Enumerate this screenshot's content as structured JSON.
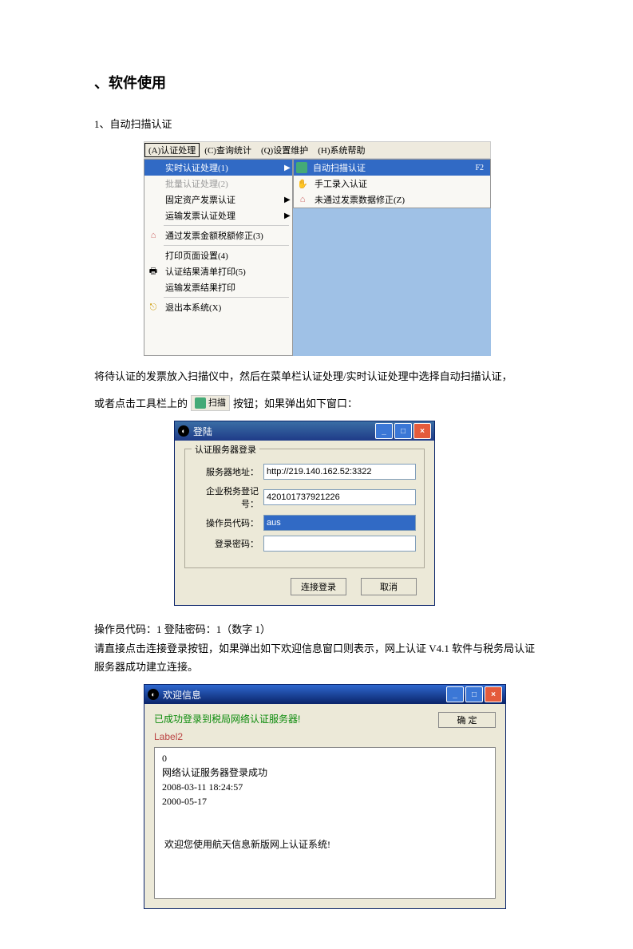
{
  "heading": "、软件使用",
  "section1_title": "1、自动扫描认证",
  "menubar": {
    "a": "(A)认证处理",
    "c": "(C)查询统计",
    "q": "(Q)设置维护",
    "h": "(H)系统帮助"
  },
  "mainmenu": {
    "i1": "实时认证处理(1)",
    "i2": "批量认证处理(2)",
    "i3": "固定资产发票认证",
    "i4": "运输发票认证处理",
    "i5": "通过发票金额税额修正(3)",
    "i6": "打印页面设置(4)",
    "i7": "认证结果清单打印(5)",
    "i8": "运输发票结果打印",
    "i9": "退出本系统(X)"
  },
  "submenu": {
    "s1": "自动扫描认证",
    "s1_key": "F2",
    "s2": "手工录入认证",
    "s3": "未通过发票数据修正(Z)"
  },
  "para_after_menu": "将待认证的发票放入扫描仪中，然后在菜单栏认证处理/实时认证处理中选择自动扫描认证，",
  "inline_before": "或者点击工具栏上的",
  "scan_btn_label": "扫描",
  "inline_after": "按钮；如果弹出如下窗口：",
  "login": {
    "title": "登陆",
    "group": "认证服务器登录",
    "f1_label": "服务器地址：",
    "f1_value": "http://219.140.162.52:3322",
    "f2_label": "企业税务登记号：",
    "f2_value": "420101737921226",
    "f3_label": "操作员代码：",
    "f3_value": "aus",
    "f4_label": "登录密码：",
    "f4_value": "",
    "btn_connect": "连接登录",
    "btn_cancel": "取消"
  },
  "para_credentials": "操作员代码：1 登陆密码：1（数字 1）",
  "para_welcome_intro": "请直接点击连接登录按钮，如果弹出如下欢迎信息窗口则表示，网上认证 V4.1 软件与税务局认证服务器成功建立连接。",
  "welcome": {
    "title": "欢迎信息",
    "success": "已成功登录到税局网络认证服务器!",
    "label2": "Label2",
    "ok": "确 定",
    "memo": " 0\n 网络认证服务器登录成功\n 2008-03-11 18:24:57\n 2000-05-17\n\n\n  欢迎您使用航天信息新版网上认证系统!"
  }
}
